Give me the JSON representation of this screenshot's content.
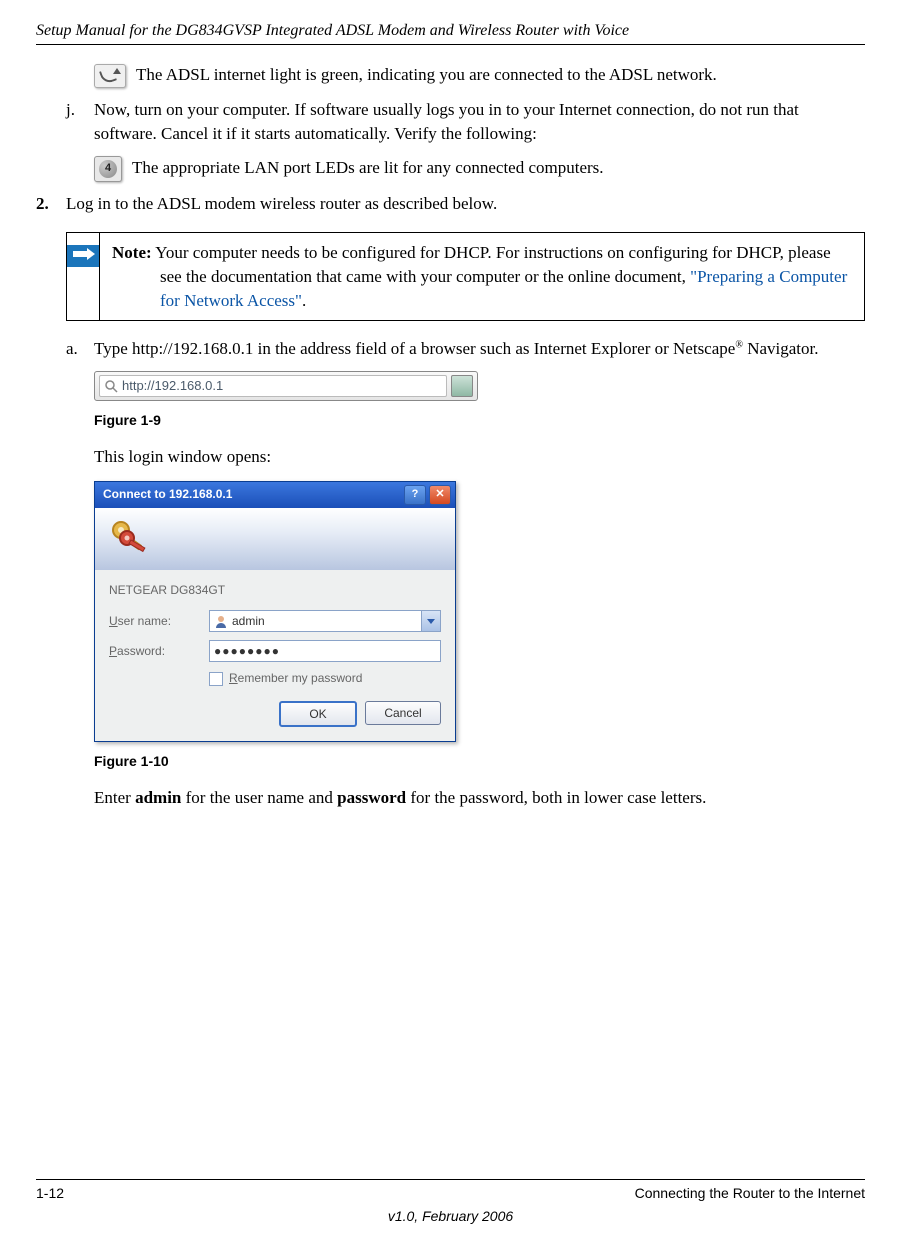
{
  "header": {
    "title": "Setup Manual for the DG834GVSP Integrated ADSL Modem and Wireless Router with Voice"
  },
  "body": {
    "adsl_text": "The ADSL internet light is green, indicating you are connected to the ADSL network.",
    "j_marker": "j.",
    "j_text": "Now, turn on your computer. If software usually logs you in to your Internet connection, do not run that software. Cancel it if it starts automatically. Verify the following:",
    "lan_icon_num": "4",
    "lan_text": "The appropriate LAN port LEDs are lit for any connected computers.",
    "step2_marker": "2.",
    "step2_text": "Log in to the ADSL modem wireless router as described below.",
    "note_label": "Note:",
    "note_text_1": " Your computer needs to be configured for DHCP. For instructions on configuring for DHCP, please see the documentation that came with your computer or the online document, ",
    "note_link": "\"Preparing a Computer for Network Access\"",
    "note_period": ".",
    "a_marker": "a.",
    "a_text_1": "Type http://192.168.0.1 in the address field of a browser such as Internet Explorer or Netscape",
    "a_text_sup": "®",
    "a_text_2": " Navigator.",
    "address_bar_value": "http://192.168.0.1",
    "fig19": "Figure 1-9",
    "login_opens": "This login window opens:",
    "login": {
      "title": "Connect to 192.168.0.1",
      "server": "NETGEAR DG834GT",
      "user_label": "User name:",
      "user_underline": "U",
      "user_value": "admin",
      "pass_label": "Password:",
      "pass_underline": "P",
      "pass_value": "●●●●●●●●",
      "remember_label": "emember my password",
      "remember_underline": "R",
      "ok": "OK",
      "cancel": "Cancel"
    },
    "fig110": "Figure 1-10",
    "final_1": "Enter ",
    "final_admin": "admin",
    "final_2": " for the user name and ",
    "final_password": "password",
    "final_3": " for the password, both in lower case letters."
  },
  "footer": {
    "page": "1-12",
    "section": "Connecting the Router to the Internet",
    "version": "v1.0, February 2006"
  }
}
